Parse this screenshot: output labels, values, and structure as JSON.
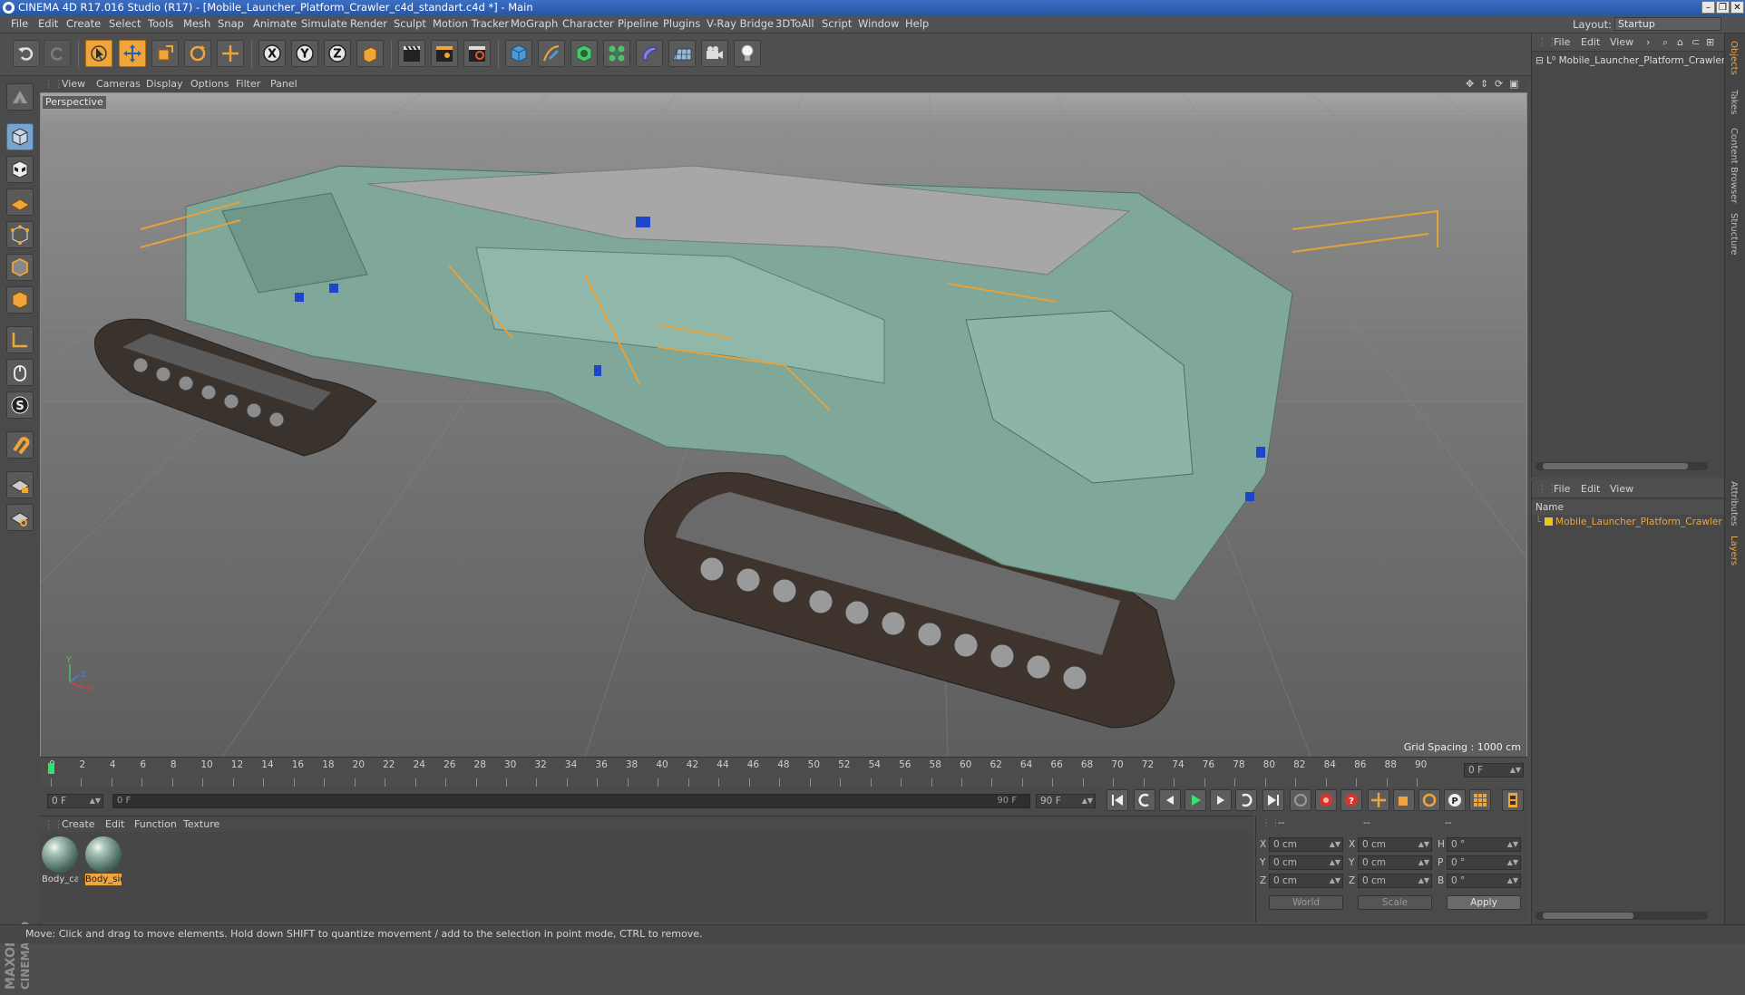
{
  "window": {
    "title": "CINEMA 4D R17.016 Studio (R17) - [Mobile_Launcher_Platform_Crawler_c4d_standart.c4d *] - Main",
    "controls": [
      "–",
      "❐",
      "✕"
    ]
  },
  "menubar": {
    "items": [
      "File",
      "Edit",
      "Create",
      "Select",
      "Tools",
      "Mesh",
      "Snap",
      "Animate",
      "Simulate",
      "Render",
      "Sculpt",
      "Motion Tracker",
      "MoGraph",
      "Character",
      "Pipeline",
      "Plugins",
      "V-Ray Bridge",
      "3DToAll",
      "Script",
      "Window",
      "Help"
    ],
    "layout_label": "Layout:",
    "layout_value": "Startup"
  },
  "toolbar": {
    "x_label": "X",
    "y_label": "Y",
    "z_label": "Z",
    "icons": [
      "undo-icon",
      "redo-icon",
      "live-selection-icon",
      "move-icon",
      "scale-icon",
      "rotate-icon",
      "recent-tool-icon",
      "x-axis-icon",
      "y-axis-icon",
      "z-axis-icon",
      "coordinate-system-icon",
      "render-view-icon",
      "render-picture-viewer-icon",
      "render-settings-icon",
      "cube-icon",
      "pen-icon",
      "subdivision-icon",
      "cloner-icon",
      "deformer-icon",
      "floor-icon",
      "camera-icon",
      "light-icon"
    ]
  },
  "viewport": {
    "menu": [
      "View",
      "Cameras",
      "Display",
      "Options",
      "Filter",
      "Panel"
    ],
    "label": "Perspective",
    "grid_spacing": "Grid Spacing : 1000 cm",
    "axis": {
      "x": "X",
      "y": "Y",
      "z": "Z"
    }
  },
  "timeline": {
    "ticks": [
      "0",
      "2",
      "4",
      "6",
      "8",
      "10",
      "12",
      "14",
      "16",
      "18",
      "20",
      "22",
      "24",
      "26",
      "28",
      "30",
      "32",
      "34",
      "36",
      "38",
      "40",
      "42",
      "44",
      "46",
      "48",
      "50",
      "52",
      "54",
      "56",
      "58",
      "60",
      "62",
      "64",
      "66",
      "68",
      "70",
      "72",
      "74",
      "76",
      "78",
      "80",
      "82",
      "84",
      "86",
      "88",
      "90"
    ],
    "current_frame": "0 F",
    "start_field": "0 F",
    "range_start": "0 F",
    "range_end": "90 F",
    "end_field": "90 F",
    "playhead_fraction": 0
  },
  "material_manager": {
    "menu": [
      "Create",
      "Edit",
      "Function",
      "Texture"
    ],
    "materials": [
      {
        "label": "Body_ca",
        "selected": false
      },
      {
        "label": "Body_sid",
        "selected": true
      }
    ]
  },
  "coordinates": {
    "header": [
      "--",
      "--",
      "--"
    ],
    "rows": [
      {
        "a": "X",
        "av": "0 cm",
        "b": "X",
        "bv": "0 cm",
        "c": "H",
        "cv": "0 °"
      },
      {
        "a": "Y",
        "av": "0 cm",
        "b": "Y",
        "bv": "0 cm",
        "c": "P",
        "cv": "0 °"
      },
      {
        "a": "Z",
        "av": "0 cm",
        "b": "Z",
        "bv": "0 cm",
        "c": "B",
        "cv": "0 °"
      }
    ],
    "world": "World",
    "scale": "Scale",
    "apply": "Apply"
  },
  "object_manager": {
    "menu": [
      "File",
      "Edit",
      "View"
    ],
    "object_name": "Mobile_Launcher_Platform_Crawler"
  },
  "layer_manager": {
    "menu": [
      "File",
      "Edit",
      "View"
    ],
    "column": "Name",
    "layer_name": "Mobile_Launcher_Platform_Crawler",
    "layer_color": "#e8c81c"
  },
  "right_tabs": [
    "Objects",
    "Takes",
    "Content Browser",
    "Structure",
    "Attributes",
    "Layers"
  ],
  "status": "Move: Click and drag to move elements. Hold down SHIFT to quantize movement / add to the selection in point mode, CTRL to remove.",
  "brand": {
    "line1": "MAXON",
    "line2": "CINEMA 4D"
  },
  "colors": {
    "accent": "#f0a53a",
    "model": "#7fa89a",
    "track": "#4a3e36"
  }
}
